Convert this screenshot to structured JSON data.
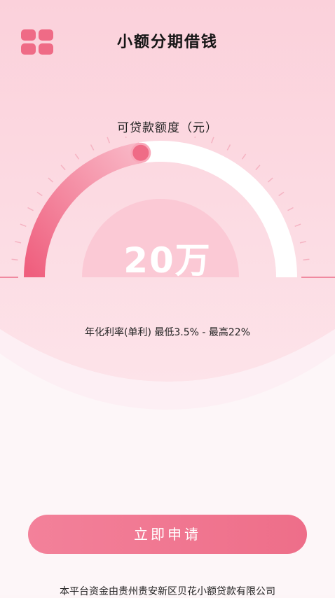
{
  "header": {
    "title": "小额分期借钱",
    "menu_icon": "grid-icon"
  },
  "gauge": {
    "label": "可贷款额度（元）",
    "amount": "20万",
    "level_fraction": 0.45
  },
  "rate_text": "年化利率(单利) 最低3.5% - 最高22%",
  "apply_button": {
    "label": "立即申请"
  },
  "footer_text": "本平台资金由贵州贵安新区贝花小额贷款有限公司",
  "colors": {
    "accent": "#ef6b86",
    "background_top": "#fbd3dd",
    "background_bottom": "#fdf5f7"
  }
}
